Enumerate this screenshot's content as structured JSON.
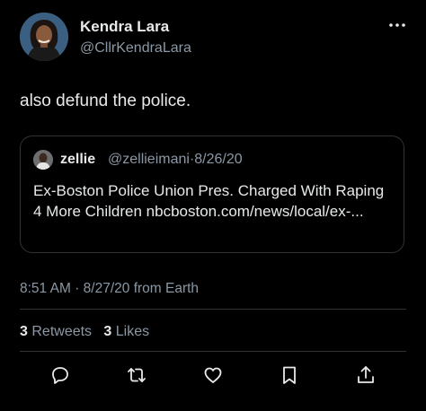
{
  "author": {
    "name": "Kendra Lara",
    "handle": "@CllrKendraLara"
  },
  "tweet": {
    "text": "also defund the police."
  },
  "quoted": {
    "name": "zellie",
    "handle": "@zellieimani",
    "separator": "·",
    "date": "8/26/20",
    "text": "Ex-Boston Police Union Pres. Charged With Raping 4 More Children nbcboston.com/news/local/ex-..."
  },
  "meta": {
    "time": "8:51 AM",
    "separator": "·",
    "date": "8/27/20",
    "source": "from Earth"
  },
  "stats": {
    "retweets_count": "3",
    "retweets_label": "Retweets",
    "likes_count": "3",
    "likes_label": "Likes"
  },
  "icons": {
    "more": "more-options-icon",
    "reply": "reply-icon",
    "retweet": "retweet-icon",
    "like": "like-icon",
    "bookmark": "bookmark-icon",
    "share": "share-icon"
  }
}
